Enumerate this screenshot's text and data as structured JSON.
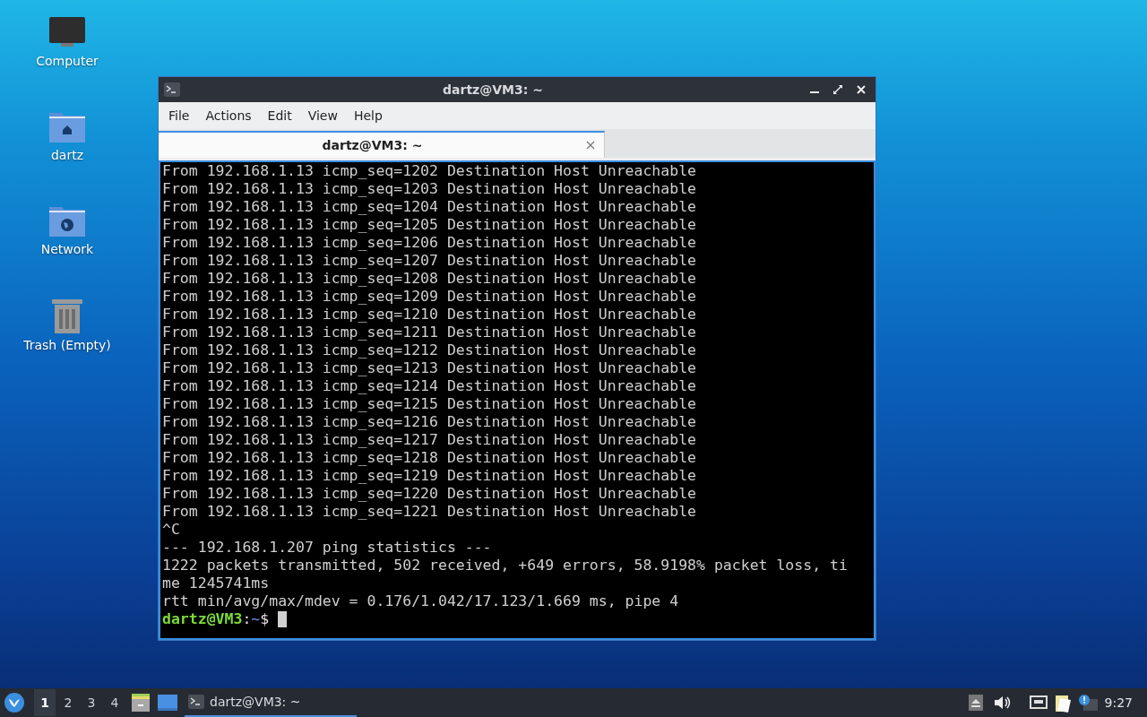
{
  "desktop_icons": [
    {
      "kind": "computer",
      "label": "Computer"
    },
    {
      "kind": "home",
      "label": "dartz"
    },
    {
      "kind": "network",
      "label": "Network"
    },
    {
      "kind": "trash",
      "label": "Trash (Empty)"
    }
  ],
  "window": {
    "title": "dartz@VM3: ~",
    "menu": [
      "File",
      "Actions",
      "Edit",
      "View",
      "Help"
    ],
    "tabs": [
      {
        "label": "dartz@VM3: ~",
        "selected": true
      }
    ],
    "terminal": {
      "lines": [
        "From 192.168.1.13 icmp_seq=1202 Destination Host Unreachable",
        "From 192.168.1.13 icmp_seq=1203 Destination Host Unreachable",
        "From 192.168.1.13 icmp_seq=1204 Destination Host Unreachable",
        "From 192.168.1.13 icmp_seq=1205 Destination Host Unreachable",
        "From 192.168.1.13 icmp_seq=1206 Destination Host Unreachable",
        "From 192.168.1.13 icmp_seq=1207 Destination Host Unreachable",
        "From 192.168.1.13 icmp_seq=1208 Destination Host Unreachable",
        "From 192.168.1.13 icmp_seq=1209 Destination Host Unreachable",
        "From 192.168.1.13 icmp_seq=1210 Destination Host Unreachable",
        "From 192.168.1.13 icmp_seq=1211 Destination Host Unreachable",
        "From 192.168.1.13 icmp_seq=1212 Destination Host Unreachable",
        "From 192.168.1.13 icmp_seq=1213 Destination Host Unreachable",
        "From 192.168.1.13 icmp_seq=1214 Destination Host Unreachable",
        "From 192.168.1.13 icmp_seq=1215 Destination Host Unreachable",
        "From 192.168.1.13 icmp_seq=1216 Destination Host Unreachable",
        "From 192.168.1.13 icmp_seq=1217 Destination Host Unreachable",
        "From 192.168.1.13 icmp_seq=1218 Destination Host Unreachable",
        "From 192.168.1.13 icmp_seq=1219 Destination Host Unreachable",
        "From 192.168.1.13 icmp_seq=1220 Destination Host Unreachable",
        "From 192.168.1.13 icmp_seq=1221 Destination Host Unreachable",
        "^C",
        "--- 192.168.1.207 ping statistics ---",
        "1222 packets transmitted, 502 received, +649 errors, 58.9198% packet loss, ti",
        "me 1245741ms",
        "rtt min/avg/max/mdev = 0.176/1.042/17.123/1.669 ms, pipe 4"
      ],
      "prompt": {
        "user": "dartz@VM3",
        "separator": ":",
        "path": "~",
        "symbol": "$"
      }
    }
  },
  "taskbar": {
    "workspaces": [
      {
        "label": "1",
        "selected": true
      },
      {
        "label": "2",
        "selected": false
      },
      {
        "label": "3",
        "selected": false
      },
      {
        "label": "4",
        "selected": false
      }
    ],
    "tasks": [
      {
        "label": "dartz@VM3: ~",
        "selected": true
      }
    ],
    "clock": "9:27"
  }
}
